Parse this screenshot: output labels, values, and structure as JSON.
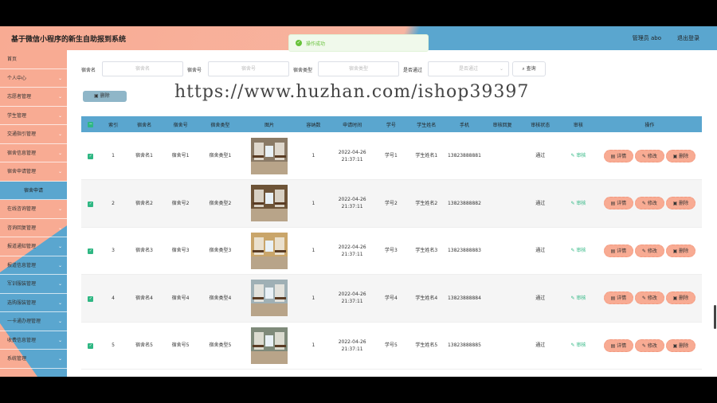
{
  "app": {
    "title": "基于微信小程序的新生自助报到系统",
    "user": "管理员 abo",
    "logout": "退出登录"
  },
  "toast": {
    "message": "操作成功"
  },
  "sidebar": {
    "items": [
      {
        "label": "首页",
        "chevron": false
      },
      {
        "label": "个人中心",
        "chevron": true
      },
      {
        "label": "志愿者管理",
        "chevron": true
      },
      {
        "label": "学生管理",
        "chevron": true
      },
      {
        "label": "交通指引管理",
        "chevron": true
      },
      {
        "label": "宿舍信息管理",
        "chevron": true
      },
      {
        "label": "宿舍申请管理",
        "chevron": true
      },
      {
        "label": "宿舍申请",
        "chevron": false,
        "sub": true
      },
      {
        "label": "在线咨询管理",
        "chevron": true
      },
      {
        "label": "咨询回复管理",
        "chevron": true
      },
      {
        "label": "报道通知管理",
        "chevron": true
      },
      {
        "label": "报道信息管理",
        "chevron": true
      },
      {
        "label": "军训服装管理",
        "chevron": true
      },
      {
        "label": "选购服装管理",
        "chevron": true
      },
      {
        "label": "一卡通办理管理",
        "chevron": true
      },
      {
        "label": "收费信息管理",
        "chevron": true
      },
      {
        "label": "系统管理",
        "chevron": true
      }
    ]
  },
  "search": {
    "dorm_name_label": "宿舍名",
    "dorm_name_placeholder": "宿舍名",
    "dorm_no_label": "宿舍号",
    "dorm_no_placeholder": "宿舍号",
    "dorm_type_label": "宿舍类型",
    "dorm_type_placeholder": "宿舍类型",
    "approved_label": "是否通过",
    "approved_placeholder": "是否通过",
    "query_button": "查询"
  },
  "toolbar": {
    "delete_label": "删除"
  },
  "watermark": "https://www.huzhan.com/ishop39397",
  "table": {
    "headers": [
      "索引",
      "宿舍名",
      "宿舍号",
      "宿舍类型",
      "图片",
      "容纳数",
      "申请时间",
      "学号",
      "学生姓名",
      "手机",
      "审核回复",
      "审核状态",
      "审核",
      "操作"
    ],
    "rows": [
      {
        "index": "1",
        "name": "宿舍名1",
        "no": "宿舍号1",
        "type": "宿舍类型1",
        "capacity": "1",
        "time": "2022-04-26 21:37:11",
        "student_id": "学号1",
        "student_name": "学生姓名1",
        "phone": "13823888881",
        "reply": "",
        "status": "通过",
        "audit": "审核"
      },
      {
        "index": "2",
        "name": "宿舍名2",
        "no": "宿舍号2",
        "type": "宿舍类型2",
        "capacity": "1",
        "time": "2022-04-26 21:37:11",
        "student_id": "学号2",
        "student_name": "学生姓名2",
        "phone": "13823888882",
        "reply": "",
        "status": "通过",
        "audit": "审核"
      },
      {
        "index": "3",
        "name": "宿舍名3",
        "no": "宿舍号3",
        "type": "宿舍类型3",
        "capacity": "1",
        "time": "2022-04-26 21:37:11",
        "student_id": "学号3",
        "student_name": "学生姓名3",
        "phone": "13823888883",
        "reply": "",
        "status": "通过",
        "audit": "审核"
      },
      {
        "index": "4",
        "name": "宿舍名4",
        "no": "宿舍号4",
        "type": "宿舍类型4",
        "capacity": "1",
        "time": "2022-04-26 21:37:11",
        "student_id": "学号4",
        "student_name": "学生姓名4",
        "phone": "13823888884",
        "reply": "",
        "status": "通过",
        "audit": "审核"
      },
      {
        "index": "5",
        "name": "宿舍名5",
        "no": "宿舍号5",
        "type": "宿舍类型5",
        "capacity": "1",
        "time": "2022-04-26 21:37:11",
        "student_id": "学号5",
        "student_name": "学生姓名5",
        "phone": "13823888885",
        "reply": "",
        "status": "通过",
        "audit": "审核"
      }
    ],
    "actions": {
      "detail": "详情",
      "edit": "修改",
      "delete": "删除"
    }
  },
  "colors": {
    "accent_salmon": "#f8ab93",
    "accent_blue": "#5aa6cf",
    "success_green": "#2fb783"
  }
}
